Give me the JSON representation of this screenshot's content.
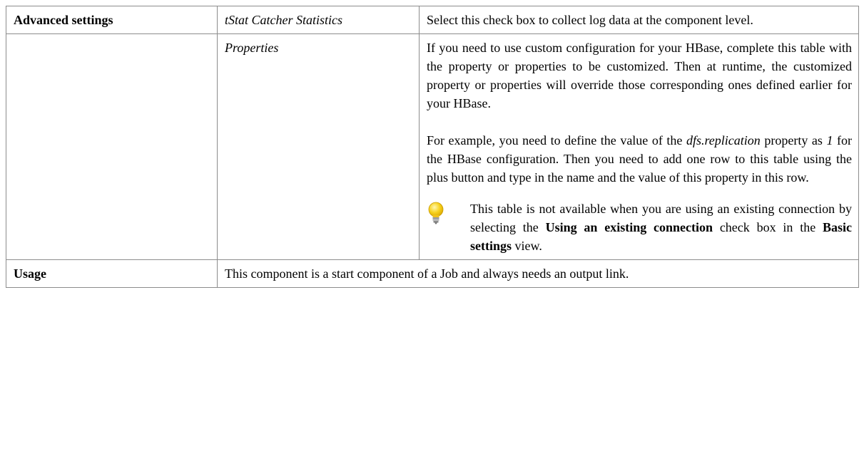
{
  "advanced": {
    "label": "Advanced settings",
    "tstat": {
      "name": "tStat Catcher Statistics",
      "desc": "Select this check box to collect log data at the component level."
    },
    "properties": {
      "name": "Properties",
      "p1": "If you need to use custom configuration for your HBase, complete this table with the property or properties to be customized. Then at runtime, the customized property or properties will override those corresponding ones defined earlier for your HBase.",
      "p2_a": "For example, you need to define the value of the ",
      "p2_term": "dfs.replication",
      "p2_b": " property as ",
      "p2_value": "1",
      "p2_c": " for the HBase configuration. Then you need to add one row to this table using the plus button and type in the name and the value of this property in this row.",
      "note_a": "This table is not available when you are using an existing connection by selecting the ",
      "note_b1": "Using an existing connection",
      "note_c": " check box in the ",
      "note_b2": "Basic settings",
      "note_d": " view."
    }
  },
  "usage": {
    "label": "Usage",
    "desc": "This component is a start component of a Job and always needs an output link."
  },
  "icons": {
    "note": "lightbulb-icon"
  },
  "colors": {
    "bulb": "#f7d11b",
    "border": "#8c8c8c"
  }
}
